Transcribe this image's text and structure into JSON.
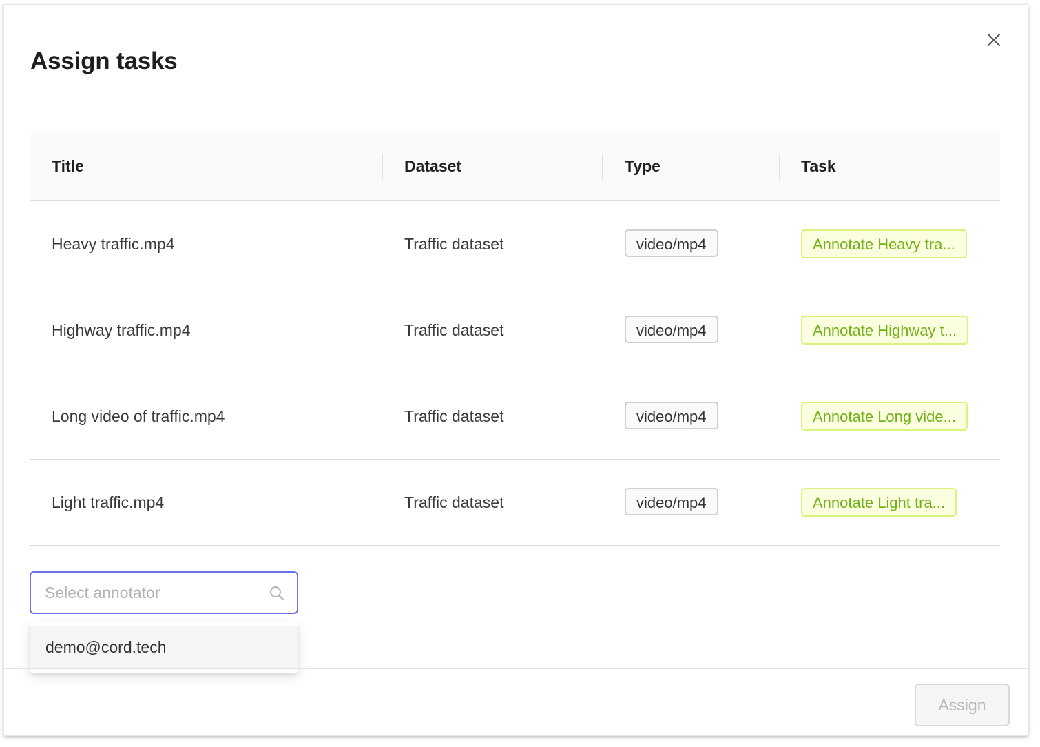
{
  "modal": {
    "title": "Assign tasks"
  },
  "table": {
    "columns": [
      "Title",
      "Dataset",
      "Type",
      "Task"
    ],
    "rows": [
      {
        "title": "Heavy traffic.mp4",
        "dataset": "Traffic dataset",
        "type": "video/mp4",
        "task": "Annotate Heavy tra..."
      },
      {
        "title": "Highway traffic.mp4",
        "dataset": "Traffic dataset",
        "type": "video/mp4",
        "task": "Annotate Highway t..."
      },
      {
        "title": "Long video of traffic.mp4",
        "dataset": "Traffic dataset",
        "type": "video/mp4",
        "task": "Annotate Long vide..."
      },
      {
        "title": "Light traffic.mp4",
        "dataset": "Traffic dataset",
        "type": "video/mp4",
        "task": "Annotate Light tra..."
      }
    ]
  },
  "annotator": {
    "placeholder": "Select annotator",
    "value": "",
    "options": [
      "demo@cord.tech"
    ]
  },
  "footer": {
    "assign_label": "Assign"
  },
  "icons": {
    "close": "close-icon",
    "search": "search-icon"
  },
  "colors": {
    "focus_border": "#6b6fe8",
    "task_tag_text": "#72b21a",
    "task_tag_bg": "#fbffe0",
    "task_tag_border": "#d8f47a",
    "disabled_button_text": "#b8b8b8"
  }
}
